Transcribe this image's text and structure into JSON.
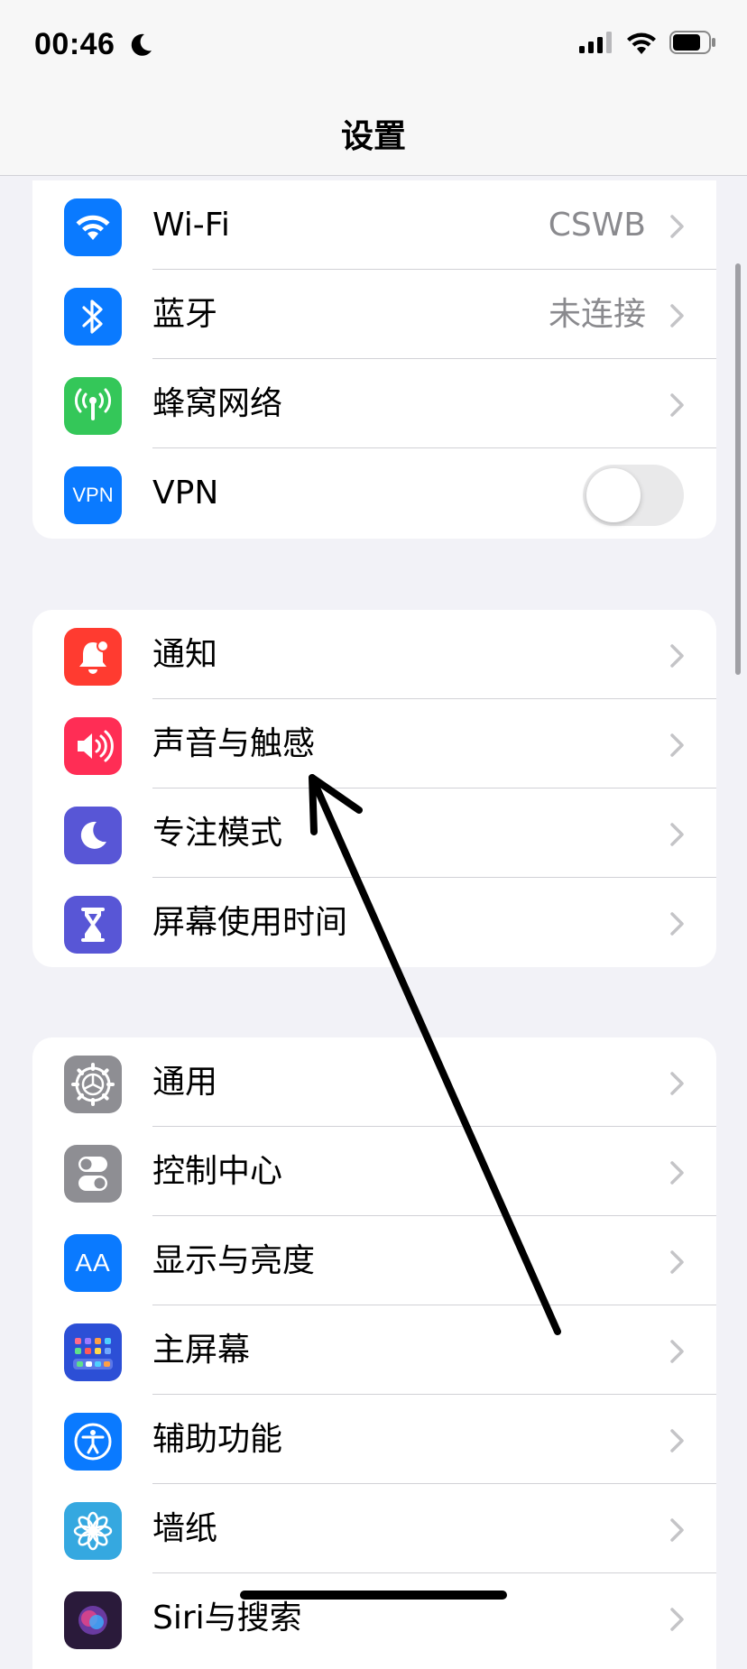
{
  "status_bar": {
    "time": "00:46",
    "icons": [
      "moon-icon",
      "cellular-signal-icon",
      "wifi-icon",
      "battery-icon"
    ]
  },
  "nav": {
    "title": "设置"
  },
  "groups": [
    {
      "name": "connectivity",
      "items": [
        {
          "label": "Wi-Fi",
          "value": "CSWB",
          "icon": "wifi-icon",
          "icon_bg": "#0a7aff"
        },
        {
          "label": "蓝牙",
          "value": "未连接",
          "icon": "bluetooth-icon",
          "icon_bg": "#0a7aff"
        },
        {
          "label": "蜂窝网络",
          "value": "",
          "icon": "cellular-antenna-icon",
          "icon_bg": "#34c759"
        },
        {
          "label": "VPN",
          "value": "",
          "icon": "vpn-icon",
          "icon_bg": "#0a7aff",
          "icon_text": "VPN",
          "toggle_on": false
        }
      ]
    },
    {
      "name": "notifications",
      "items": [
        {
          "label": "通知",
          "icon": "bell-icon",
          "icon_bg": "#ff3b30"
        },
        {
          "label": "声音与触感",
          "icon": "speaker-icon",
          "icon_bg": "#ff2d55"
        },
        {
          "label": "专注模式",
          "icon": "moon-icon",
          "icon_bg": "#5856d6"
        },
        {
          "label": "屏幕使用时间",
          "icon": "hourglass-icon",
          "icon_bg": "#5856d6"
        }
      ]
    },
    {
      "name": "general",
      "items": [
        {
          "label": "通用",
          "icon": "gear-icon",
          "icon_bg": "#8e8e93"
        },
        {
          "label": "控制中心",
          "icon": "toggles-icon",
          "icon_bg": "#8e8e93"
        },
        {
          "label": "显示与亮度",
          "icon": "text-size-icon",
          "icon_bg": "#0a7aff",
          "icon_text": "AA"
        },
        {
          "label": "主屏幕",
          "icon": "home-screen-icon",
          "icon_bg": "#2c4fd6"
        },
        {
          "label": "辅助功能",
          "icon": "accessibility-icon",
          "icon_bg": "#0a7aff"
        },
        {
          "label": "墙纸",
          "icon": "flower-icon",
          "icon_bg": "#35a8e0"
        },
        {
          "label": "Siri与搜索",
          "icon": "siri-icon",
          "icon_bg": "#2a1a3a"
        }
      ]
    }
  ],
  "colors": {
    "background": "#f2f2f7",
    "cell": "#ffffff",
    "separator": "#d1d1d6",
    "secondary_text": "#8a8a8e",
    "chevron": "#c4c4c7"
  }
}
